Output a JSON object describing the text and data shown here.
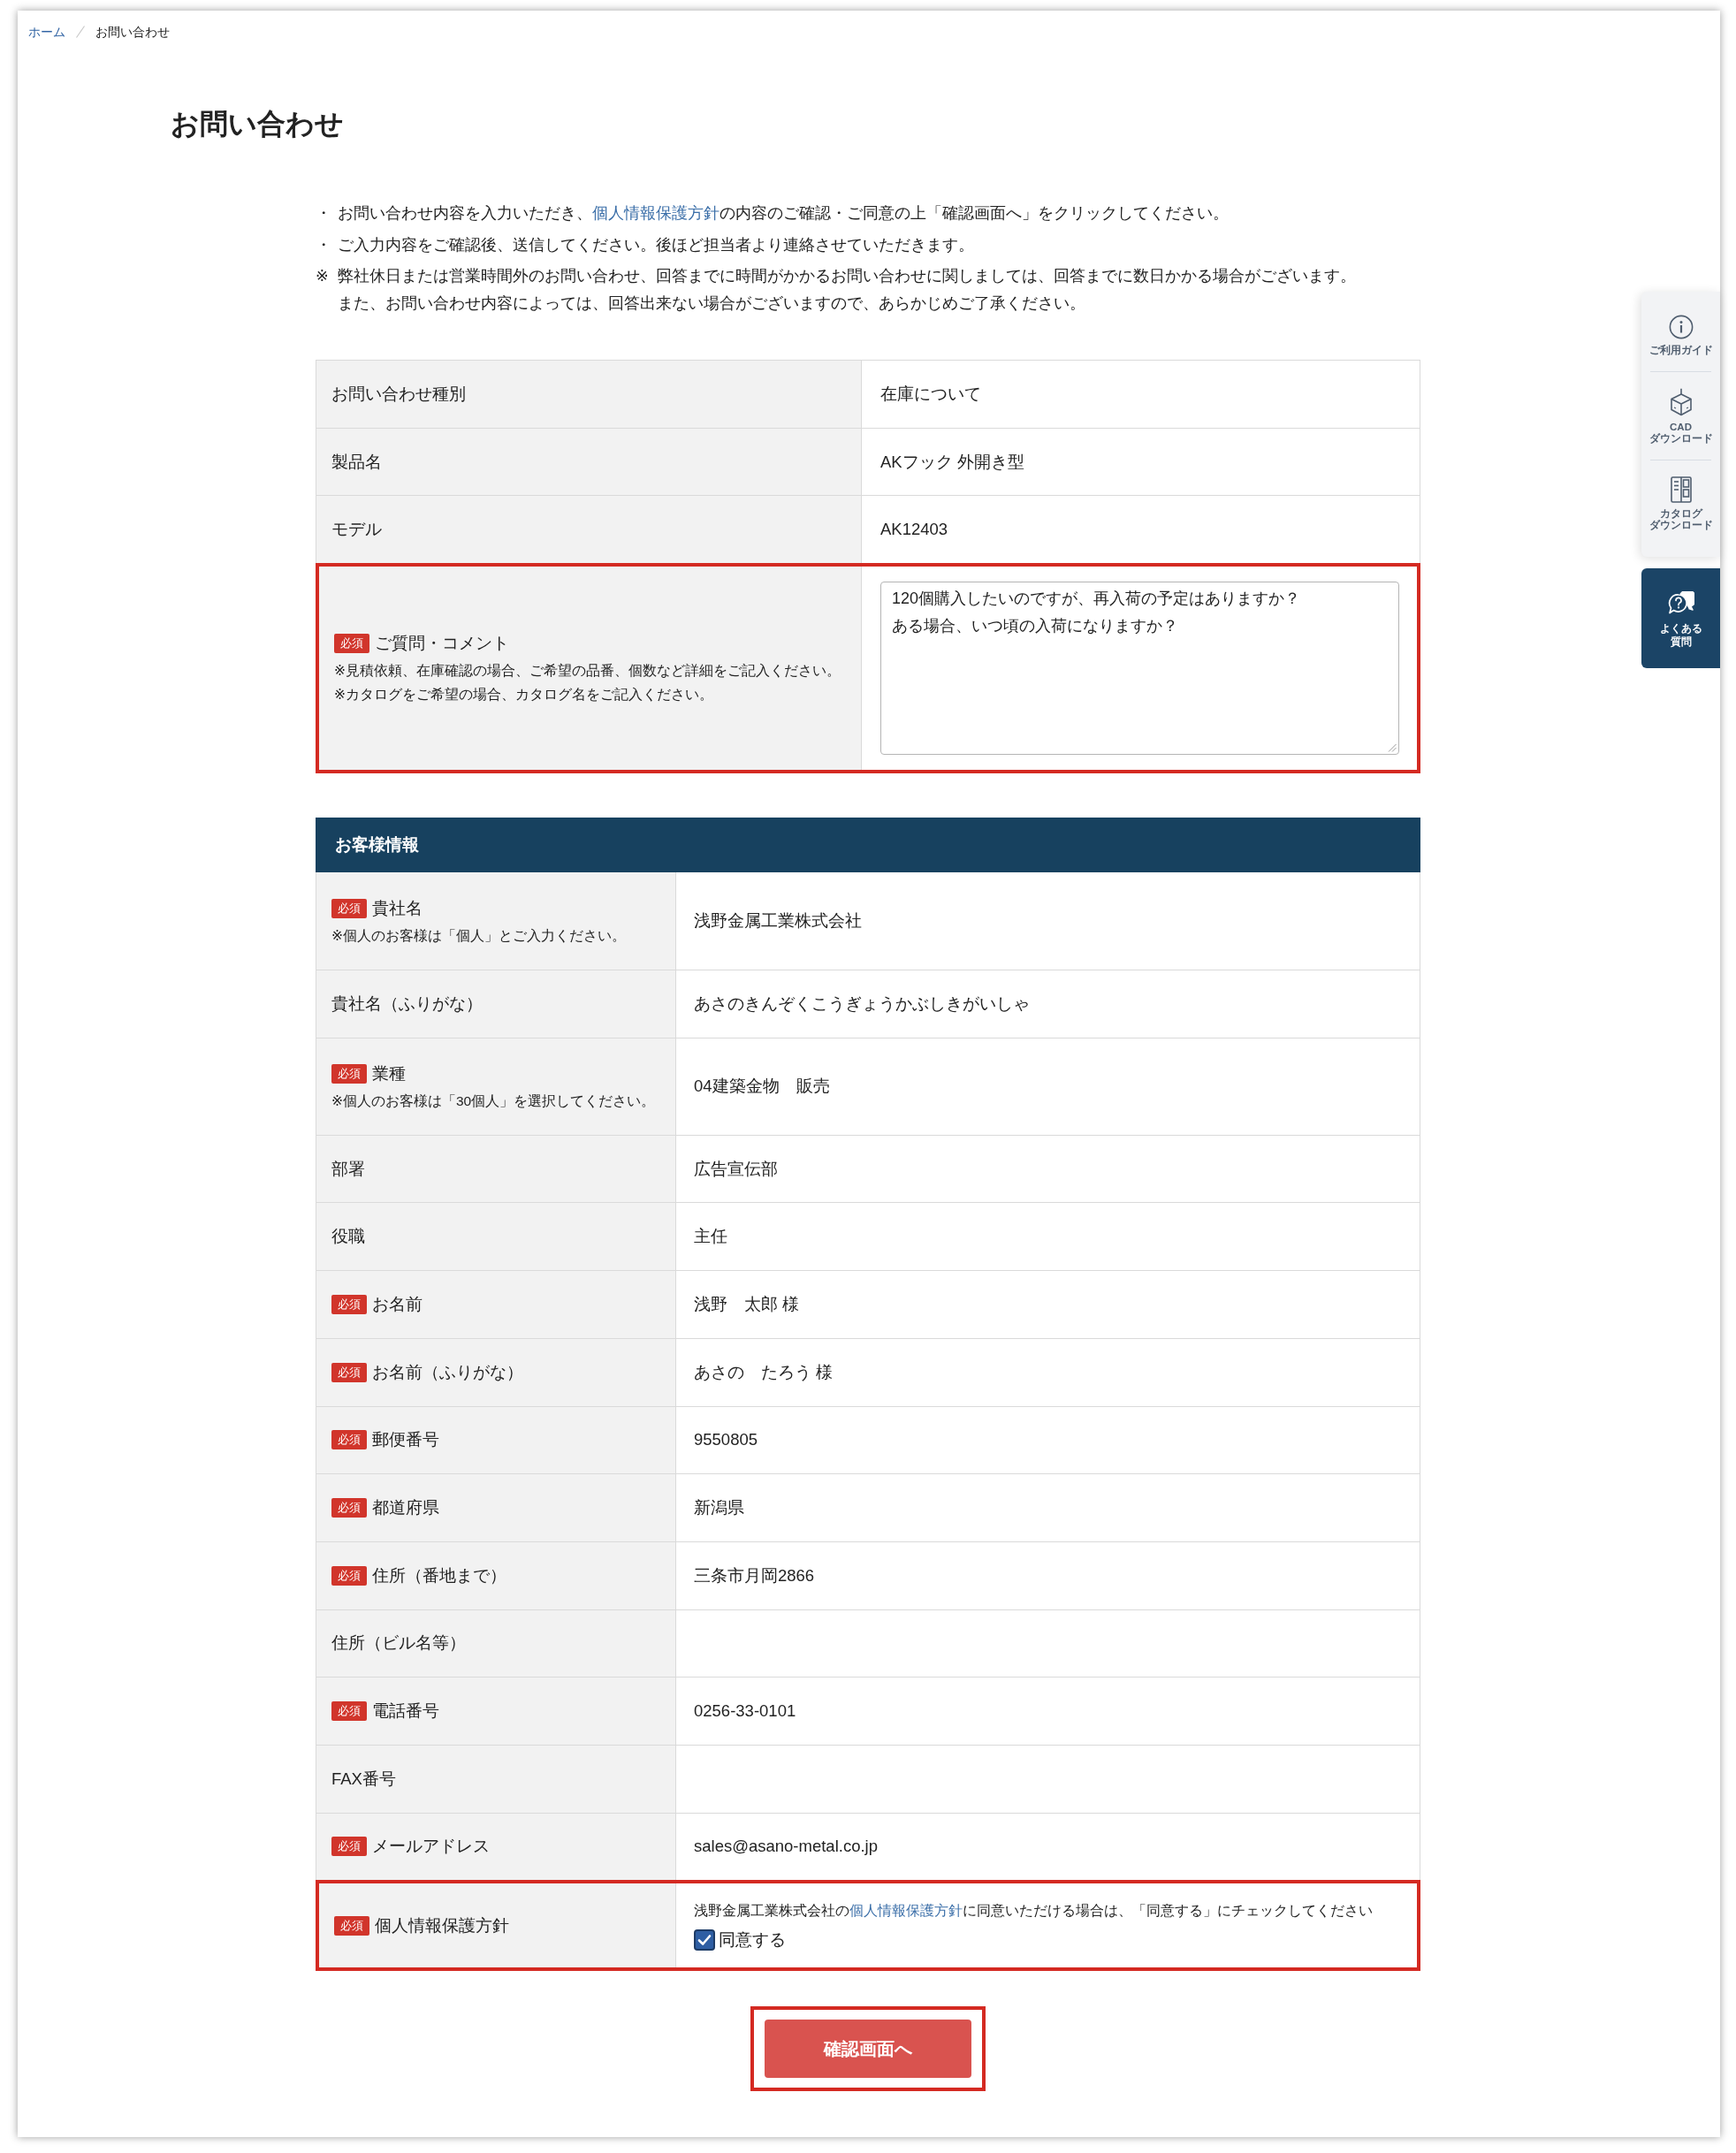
{
  "breadcrumb": [
    {
      "label": "ホーム",
      "current": false
    },
    {
      "label": "お問い合わせ",
      "current": true
    }
  ],
  "page_title": "お問い合わせ",
  "notes": [
    {
      "mark": "・",
      "lines": [
        {
          "parts": [
            {
              "kind": "text",
              "text": "お問い合わせ内容を入力いただき、"
            },
            {
              "kind": "link",
              "text": "個人情報保護方針"
            },
            {
              "kind": "text",
              "text": "の内容のご確認・ご同意の上「確認画面へ」をクリックしてください。"
            }
          ]
        }
      ]
    },
    {
      "mark": "・",
      "lines": [
        {
          "parts": [
            {
              "kind": "text",
              "text": "ご入力内容をご確認後、送信してください。後ほど担当者より連絡させていただきます。"
            }
          ]
        }
      ]
    },
    {
      "mark": "※",
      "lines": [
        {
          "parts": [
            {
              "kind": "text",
              "text": "弊社休日または営業時間外のお問い合わせ、回答までに時間がかかるお問い合わせに関しましては、回答までに数日かかる場合がございます。"
            }
          ]
        },
        {
          "parts": [
            {
              "kind": "text",
              "text": "また、お問い合わせ内容によっては、回答出来ない場合がございますので、あらかじめご了承ください。"
            }
          ]
        }
      ]
    }
  ],
  "inquiry": {
    "rows": [
      {
        "label": "お問い合わせ種別",
        "kind": "text",
        "value": "在庫について",
        "highlighted": false
      },
      {
        "label": "製品名",
        "kind": "text",
        "value": "AKフック 外開き型",
        "highlighted": false
      },
      {
        "label": "モデル",
        "kind": "text",
        "value": "AK12403",
        "highlighted": false
      },
      {
        "label": "ご質問・コメント",
        "badge": "必須",
        "notes": [
          "※見積依頼、在庫確認の場合、ご希望の品番、個数など詳細をご記入ください。",
          "※カタログをご希望の場合、カタログ名をご記入ください。"
        ],
        "kind": "textarea",
        "lines": [
          "120個購入したいのですが、再入荷の予定はありますか？",
          "ある場合、いつ頃の入荷になりますか？"
        ],
        "highlighted": true
      }
    ]
  },
  "customer": {
    "title": "お客様情報",
    "rows": [
      {
        "label": "貴社名",
        "badge": "必須",
        "notes": [
          "※個人のお客様は「個人」とご入力ください。"
        ],
        "kind": "text",
        "value": "浅野金属工業株式会社",
        "highlighted": false
      },
      {
        "label": "貴社名（ふりがな）",
        "kind": "text",
        "value": "あさのきんぞくこうぎょうかぶしきがいしゃ",
        "highlighted": false
      },
      {
        "label": "業種",
        "badge": "必須",
        "notes": [
          "※個人のお客様は「30個人」を選択してください。"
        ],
        "kind": "text",
        "value": "04建築金物　販売",
        "highlighted": false
      },
      {
        "label": "部署",
        "kind": "text",
        "value": "広告宣伝部",
        "highlighted": false
      },
      {
        "label": "役職",
        "kind": "text",
        "value": "主任",
        "highlighted": false
      },
      {
        "label": "お名前",
        "badge": "必須",
        "kind": "text",
        "value": "浅野　太郎 様",
        "highlighted": false
      },
      {
        "label": "お名前（ふりがな）",
        "badge": "必須",
        "kind": "text",
        "value": "あさの　たろう 様",
        "highlighted": false
      },
      {
        "label": "郵便番号",
        "badge": "必須",
        "kind": "text",
        "value": "9550805",
        "highlighted": false
      },
      {
        "label": "都道府県",
        "badge": "必須",
        "kind": "text",
        "value": "新潟県",
        "highlighted": false
      },
      {
        "label": "住所（番地まで）",
        "badge": "必須",
        "kind": "text",
        "value": "三条市月岡2866",
        "highlighted": false
      },
      {
        "label": "住所（ビル名等）",
        "kind": "text",
        "highlighted": false
      },
      {
        "label": "電話番号",
        "badge": "必須",
        "kind": "text",
        "value": "0256-33-0101",
        "highlighted": false
      },
      {
        "label": "FAX番号",
        "kind": "text",
        "highlighted": false
      },
      {
        "label": "メールアドレス",
        "badge": "必須",
        "kind": "text",
        "value": "sales@asano-metal.co.jp",
        "highlighted": false
      },
      {
        "label": "個人情報保護方針",
        "badge": "必須",
        "kind": "consent",
        "parts": [
          {
            "kind": "text",
            "text": "浅野金属工業株式会社の"
          },
          {
            "kind": "link",
            "text": "個人情報保護方針"
          },
          {
            "kind": "text",
            "text": "に同意いただける場合は、「同意する」にチェックしてください"
          }
        ],
        "checkbox": {
          "label": "同意する",
          "checked": true
        },
        "highlighted": true
      }
    ]
  },
  "confirm_button": {
    "label": "確認画面へ",
    "highlighted": true
  },
  "side_menu": {
    "items": [
      {
        "kind": "info",
        "lines": [
          "ご利用ガイド"
        ]
      },
      {
        "kind": "cad",
        "lines": [
          "CAD",
          "ダウンロード"
        ]
      },
      {
        "kind": "catalog",
        "lines": [
          "カタログ",
          "ダウンロード"
        ]
      }
    ],
    "faq": {
      "label": "よくある質問"
    }
  }
}
